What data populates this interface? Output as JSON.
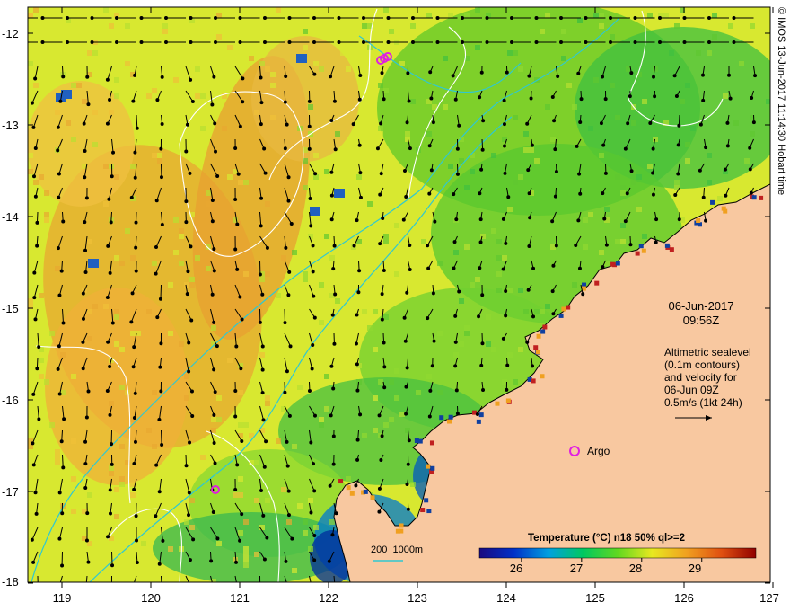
{
  "map": {
    "datetime": {
      "date": "06-Jun-2017",
      "time": "09:56Z"
    },
    "annotation_lines": [
      "Altimetric sealevel",
      "(0.1m contours)",
      "and velocity for",
      "06-Jun 09Z",
      "0.5m/s (1kt 24h)"
    ],
    "argo_label": "Argo",
    "depth_legend": "200  1000m",
    "colorbar": {
      "title": "Temperature (°C) n18 50% ql>=2",
      "ticks": [
        "26",
        "27",
        "28",
        "29"
      ],
      "range": [
        25.3,
        29.9
      ],
      "stops": [
        "#1a0a80",
        "#0030c8",
        "#00a0e0",
        "#00c860",
        "#60d820",
        "#e8e820",
        "#f0a020",
        "#e05010",
        "#900000"
      ]
    },
    "lon_ticks": [
      "119",
      "120",
      "121",
      "122",
      "123",
      "124",
      "125",
      "126",
      "127"
    ],
    "lat_ticks": [
      "-12",
      "-13",
      "-14",
      "-15",
      "-16",
      "-17",
      "-18"
    ],
    "credit": "© IMOS 13-Jun-2017 11:14:30 Hobart time",
    "colors": {
      "land": "#f8c8a0",
      "contour": "#ffffff",
      "isobath": "#30c8d0",
      "argo": "#e020e0",
      "arrow": "#000000"
    }
  }
}
